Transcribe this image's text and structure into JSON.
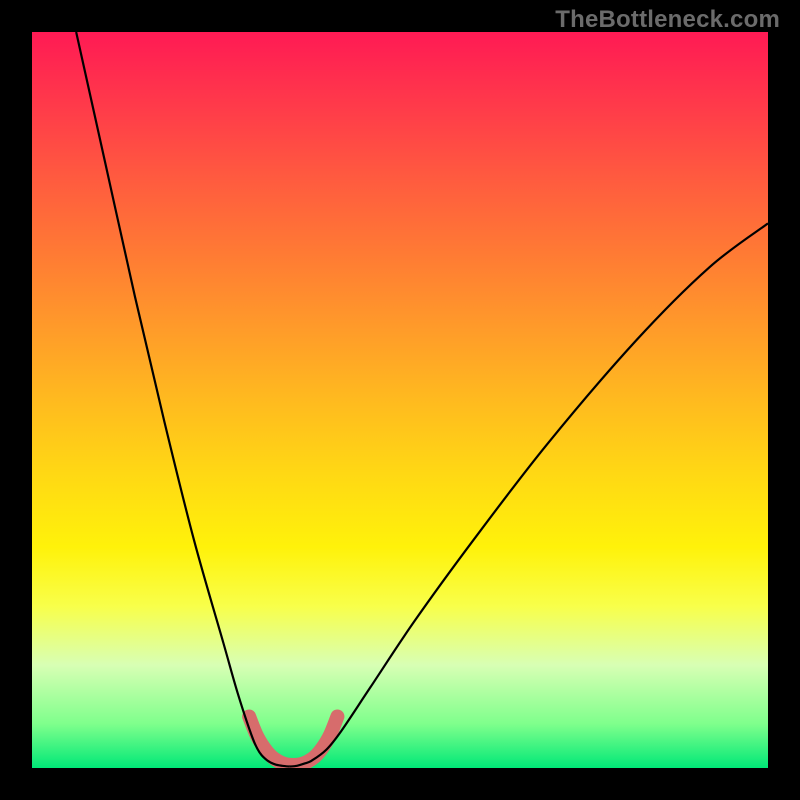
{
  "watermark": "TheBottleneck.com",
  "chart_data": {
    "type": "line",
    "title": "",
    "xlabel": "",
    "ylabel": "",
    "xlim": [
      0,
      100
    ],
    "ylim": [
      0,
      100
    ],
    "grid": false,
    "legend": false,
    "gradient_stops": [
      {
        "pos": 0,
        "color": "#ff1a54"
      },
      {
        "pos": 10,
        "color": "#ff3a4a"
      },
      {
        "pos": 20,
        "color": "#ff5b3f"
      },
      {
        "pos": 30,
        "color": "#ff7a34"
      },
      {
        "pos": 40,
        "color": "#ff9a2a"
      },
      {
        "pos": 50,
        "color": "#ffba1f"
      },
      {
        "pos": 60,
        "color": "#ffd814"
      },
      {
        "pos": 70,
        "color": "#fff20a"
      },
      {
        "pos": 78,
        "color": "#f8ff4a"
      },
      {
        "pos": 86,
        "color": "#d8ffb4"
      },
      {
        "pos": 94,
        "color": "#7fff8c"
      },
      {
        "pos": 100,
        "color": "#00e877"
      }
    ],
    "series": [
      {
        "name": "curve-left",
        "stroke": "#000000",
        "stroke_width": 2.2,
        "x": [
          6,
          10,
          14,
          18,
          22,
          26,
          28,
          30,
          31,
          32,
          33,
          34,
          35
        ],
        "y": [
          100,
          82,
          64,
          47,
          31,
          17,
          10,
          4,
          2,
          1,
          0.5,
          0.3,
          0.2
        ]
      },
      {
        "name": "curve-right",
        "stroke": "#000000",
        "stroke_width": 2.2,
        "x": [
          35,
          36,
          37,
          38,
          40,
          42,
          46,
          52,
          60,
          70,
          82,
          92,
          100
        ],
        "y": [
          0.2,
          0.3,
          0.6,
          1,
          2.5,
          5,
          11,
          20,
          31,
          44,
          58,
          68,
          74
        ]
      },
      {
        "name": "trough-highlight",
        "stroke": "#d76c6c",
        "stroke_width": 14,
        "linecap": "round",
        "linejoin": "round",
        "x": [
          29.5,
          30.5,
          31.5,
          32.5,
          33.5,
          34.5,
          35.5,
          36.5,
          37.5,
          38.5,
          39.5,
          40.5,
          41.5
        ],
        "y": [
          7,
          4.5,
          2.8,
          1.6,
          0.9,
          0.5,
          0.4,
          0.5,
          0.9,
          1.6,
          2.8,
          4.5,
          7
        ]
      }
    ]
  }
}
